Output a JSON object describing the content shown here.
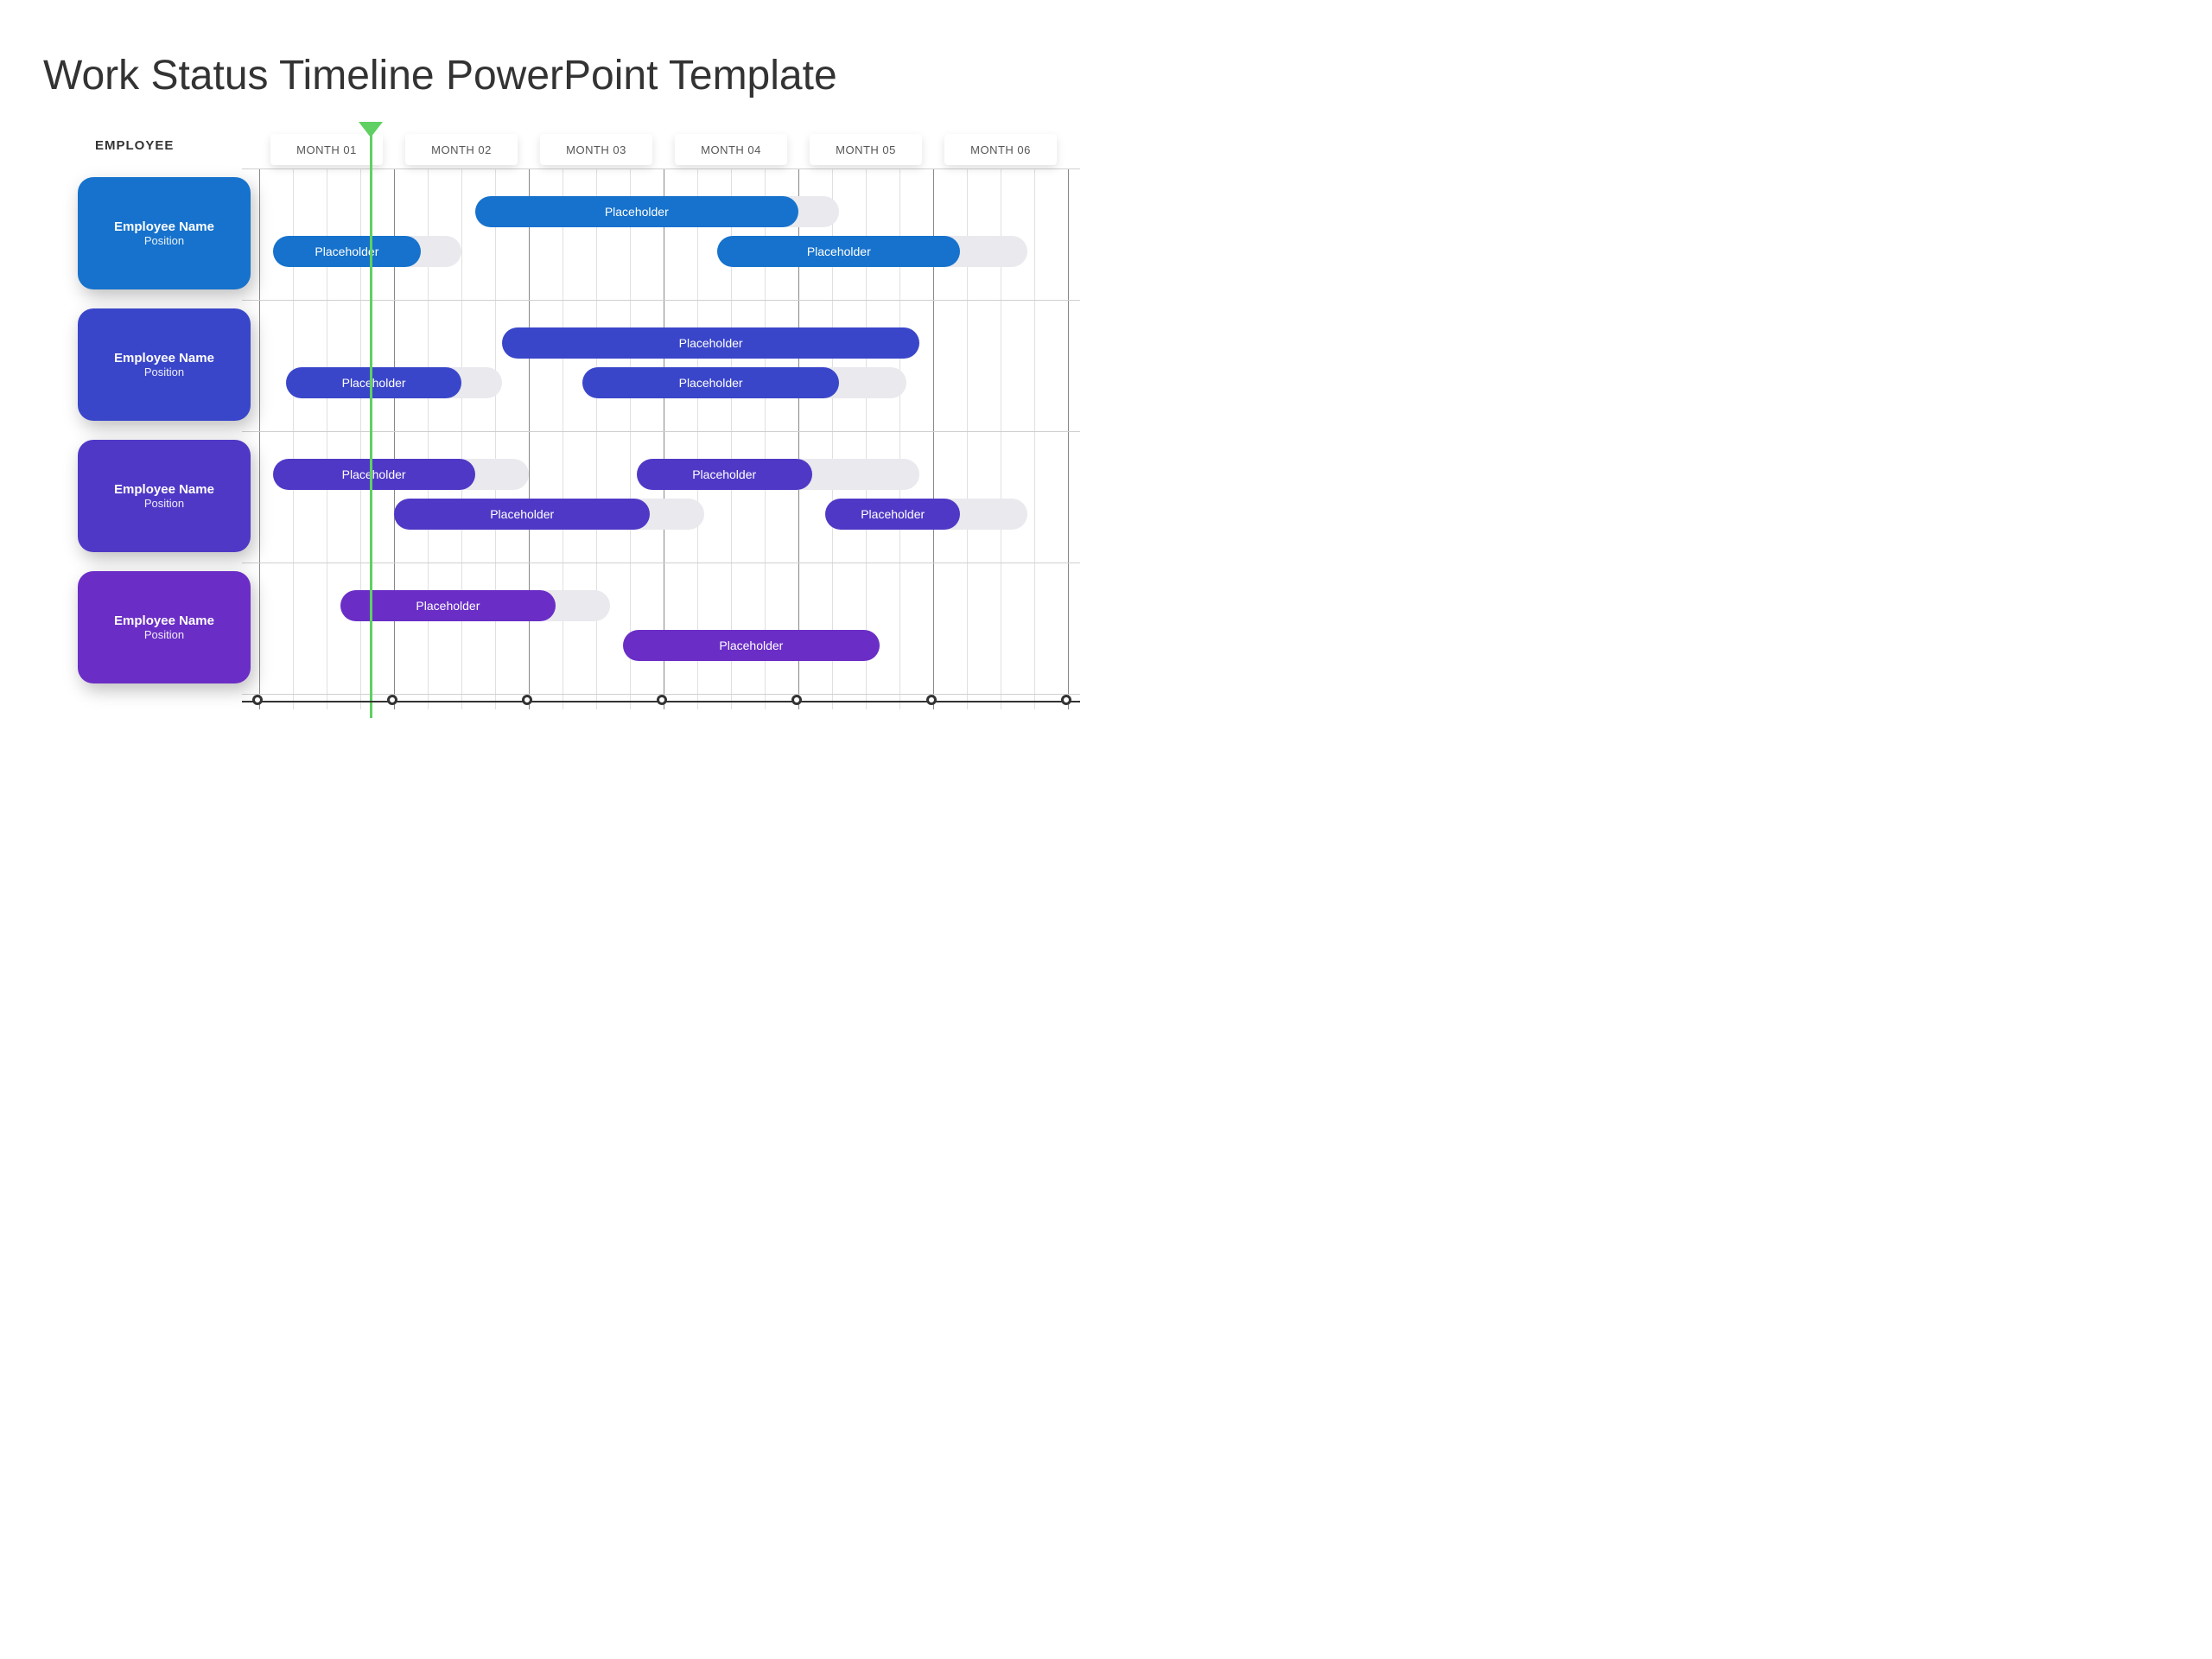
{
  "title": "Work Status Timeline PowerPoint Template",
  "employee_header": "EMPLOYEE",
  "months": [
    "MONTH 01",
    "MONTH 02",
    "MONTH 03",
    "MONTH 04",
    "MONTH 05",
    "MONTH 06"
  ],
  "employees": [
    {
      "name": "Employee Name",
      "position": "Position",
      "color": "#1672cc"
    },
    {
      "name": "Employee Name",
      "position": "Position",
      "color": "#3a46c9"
    },
    {
      "name": "Employee Name",
      "position": "Position",
      "color": "#5038c6"
    },
    {
      "name": "Employee Name",
      "position": "Position",
      "color": "#6a2ec6"
    }
  ],
  "marker_at_month_fraction": 0.83,
  "chart_data": {
    "type": "gantt",
    "x_axis": {
      "unit": "month",
      "range": [
        0,
        6
      ],
      "ticks": [
        0,
        1,
        2,
        3,
        4,
        5,
        6
      ]
    },
    "rows": [
      {
        "employee_index": 0,
        "tasks": [
          {
            "label": "Placeholder",
            "start": 1.6,
            "end": 4.0,
            "track_end": 4.3,
            "lane": 0
          },
          {
            "label": "Placeholder",
            "start": 0.1,
            "end": 1.2,
            "track_end": 1.5,
            "lane": 1
          },
          {
            "label": "Placeholder",
            "start": 3.4,
            "end": 5.2,
            "track_end": 5.7,
            "lane": 1
          }
        ]
      },
      {
        "employee_index": 1,
        "tasks": [
          {
            "label": "Placeholder",
            "start": 1.8,
            "end": 4.9,
            "track_end": 4.9,
            "lane": 0
          },
          {
            "label": "Placeholder",
            "start": 0.2,
            "end": 1.5,
            "track_end": 1.8,
            "lane": 1
          },
          {
            "label": "Placeholder",
            "start": 2.4,
            "end": 4.3,
            "track_end": 4.8,
            "lane": 1
          }
        ]
      },
      {
        "employee_index": 2,
        "tasks": [
          {
            "label": "Placeholder",
            "start": 0.1,
            "end": 1.6,
            "track_end": 2.0,
            "lane": 0
          },
          {
            "label": "Placeholder",
            "start": 2.8,
            "end": 4.1,
            "track_end": 4.9,
            "lane": 0
          },
          {
            "label": "Placeholder",
            "start": 1.0,
            "end": 2.9,
            "track_end": 3.3,
            "lane": 1
          },
          {
            "label": "Placeholder",
            "start": 4.2,
            "end": 5.2,
            "track_end": 5.7,
            "lane": 1
          }
        ]
      },
      {
        "employee_index": 3,
        "tasks": [
          {
            "label": "Placeholder",
            "start": 0.6,
            "end": 2.2,
            "track_end": 2.6,
            "lane": 0
          },
          {
            "label": "Placeholder",
            "start": 2.7,
            "end": 4.6,
            "track_end": 4.6,
            "lane": 1
          }
        ]
      }
    ]
  }
}
